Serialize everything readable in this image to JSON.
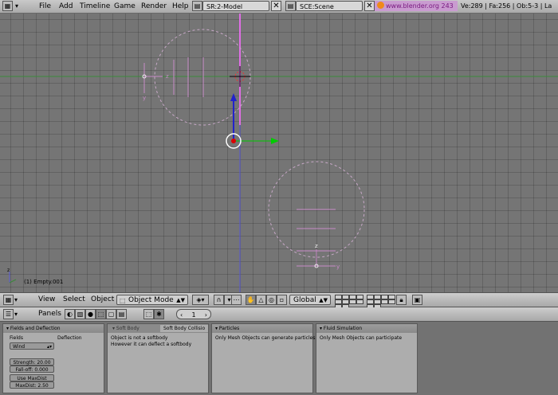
{
  "top_header": {
    "menus": [
      "File",
      "Add",
      "Timeline",
      "Game",
      "Render",
      "Help"
    ],
    "screen": "SR:2-Model",
    "scene": "SCE:Scene",
    "url": "www.blender.org 243",
    "stats": "Ve:289 | Fa:256 | Ob:5-3 | La"
  },
  "viewport": {
    "object_label": "(1) Empty.001",
    "axis_labels": {
      "z1": "z",
      "y1": "y",
      "z2": "z",
      "y2": "y"
    },
    "colors": {
      "grid_bg": "#757575",
      "x_axis_line": "#3a8a3a",
      "z_line": "#e06ee6",
      "y_line": "#5a5ad8",
      "manip_z": "#2222cc",
      "manip_y": "#00cc00"
    }
  },
  "view3d_header": {
    "menus": [
      "View",
      "Select",
      "Object"
    ],
    "mode": "Object Mode",
    "orientation": "Global"
  },
  "buttons_header": {
    "panels_label": "Panels",
    "frame_value": "1"
  },
  "panels": {
    "fields": {
      "title": "Fields and Deflection",
      "tab_fields": "Fields",
      "tab_deflection": "Deflection",
      "field_type": "Wind",
      "strength": "Strength: 20.00",
      "falloff": "Fall-off: 0.000",
      "use_maxdist": "Use MaxDist",
      "maxdist": "MaxDist: 2.50"
    },
    "softbody": {
      "tab1": "Soft Body",
      "tab2": "Soft Body Collisio",
      "line1": "Object is not a softbody",
      "line2": "However it can deflect a softbody"
    },
    "particles": {
      "title": "Particles",
      "text": "Only Mesh Objects can generate particles"
    },
    "fluid": {
      "title": "Fluid Simulation",
      "text": "Only Mesh Objects can participate"
    }
  }
}
